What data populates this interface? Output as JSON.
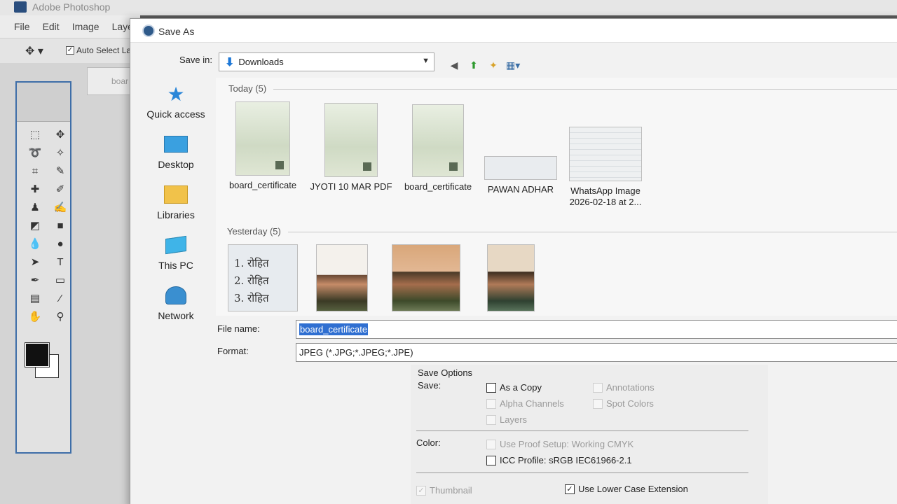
{
  "photoshop": {
    "title": "Adobe Photoshop",
    "menu": [
      "File",
      "Edit",
      "Image",
      "Layer"
    ],
    "options_bar": {
      "auto_select_label": "Auto Select Lay",
      "auto_select_checked": true
    },
    "doc_tab": "boar"
  },
  "dialog": {
    "title": "Save As",
    "save_in": {
      "label": "Save in:",
      "value": "Downloads"
    },
    "places": [
      {
        "label": "Quick access",
        "icon": "star-icon"
      },
      {
        "label": "Desktop",
        "icon": "desktop-icon"
      },
      {
        "label": "Libraries",
        "icon": "folder-icon"
      },
      {
        "label": "This PC",
        "icon": "computer-icon"
      },
      {
        "label": "Network",
        "icon": "globe-icon"
      }
    ],
    "groups": [
      {
        "header": "Today (5)",
        "files": [
          {
            "name": "board_certificate"
          },
          {
            "name": "JYOTI 10 MAR PDF"
          },
          {
            "name": "board_certificate"
          },
          {
            "name": "PAWAN ADHAR"
          },
          {
            "name": "WhatsApp Image",
            "name2": "2026-02-18 at 2..."
          }
        ]
      },
      {
        "header": "Yesterday (5)",
        "files": [
          {
            "name": "",
            "thumb_lines": [
              "1. रोहित",
              "2. रोहित",
              "3. रोहित"
            ]
          },
          {
            "name": ""
          },
          {
            "name": ""
          },
          {
            "name": ""
          }
        ]
      }
    ],
    "file_name": {
      "label": "File name:",
      "value": "board_certificate"
    },
    "format": {
      "label": "Format:",
      "value": "JPEG (*.JPG;*.JPEG;*.JPE)"
    },
    "save_options": {
      "title": "Save Options",
      "save_label": "Save:",
      "as_a_copy": {
        "label": "As a Copy",
        "checked": false,
        "enabled": true
      },
      "annotations": {
        "label": "Annotations",
        "checked": false,
        "enabled": false
      },
      "alpha_channels": {
        "label": "Alpha Channels",
        "checked": false,
        "enabled": false
      },
      "spot_colors": {
        "label": "Spot Colors",
        "checked": false,
        "enabled": false
      },
      "layers": {
        "label": "Layers",
        "checked": false,
        "enabled": false
      },
      "color_label": "Color:",
      "use_proof_setup": {
        "label": "Use Proof Setup:  Working CMYK",
        "checked": false,
        "enabled": false
      },
      "icc_profile": {
        "label": "ICC Profile:  sRGB IEC61966-2.1",
        "checked": false,
        "enabled": true
      },
      "thumbnail": {
        "label": "Thumbnail",
        "checked": true,
        "enabled": false
      },
      "lower_case_ext": {
        "label": "Use Lower Case Extension",
        "checked": true,
        "enabled": true
      }
    }
  }
}
